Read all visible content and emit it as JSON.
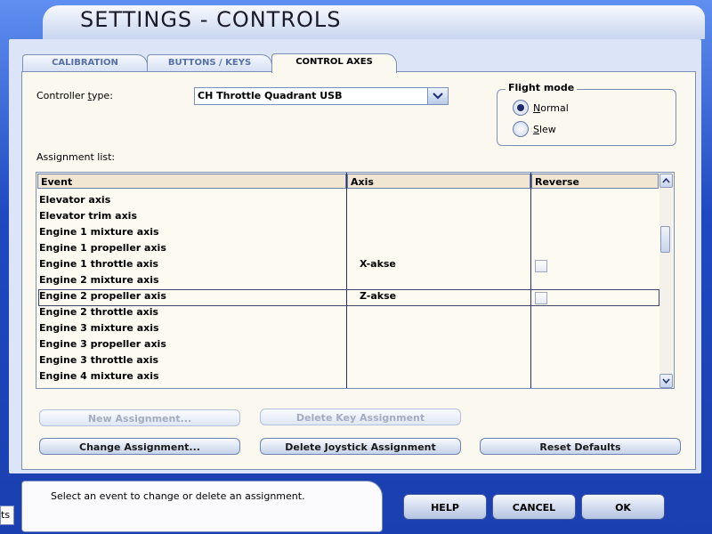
{
  "window": {
    "title": "SETTINGS - CONTROLS"
  },
  "tabs": [
    {
      "label": "CALIBRATION"
    },
    {
      "label": "BUTTONS / KEYS"
    },
    {
      "label": "CONTROL AXES",
      "active": true
    }
  ],
  "controller": {
    "label": "Controller type:",
    "value": "CH Throttle Quadrant USB"
  },
  "flight_mode": {
    "legend": "Flight mode",
    "options": [
      {
        "label": "Normal",
        "selected": true
      },
      {
        "label": "Slew",
        "selected": false
      }
    ]
  },
  "assignment": {
    "label": "Assignment list:",
    "columns": [
      "Event",
      "Axis",
      "Reverse"
    ],
    "rows": [
      {
        "event": "Elevator axis",
        "axis": "",
        "reverse": null
      },
      {
        "event": "Elevator trim axis",
        "axis": "",
        "reverse": null
      },
      {
        "event": "Engine 1 mixture axis",
        "axis": "",
        "reverse": null
      },
      {
        "event": "Engine 1 propeller axis",
        "axis": "",
        "reverse": null
      },
      {
        "event": "Engine 1 throttle axis",
        "axis": "X-akse",
        "reverse": false
      },
      {
        "event": "Engine 2 mixture axis",
        "axis": "",
        "reverse": null
      },
      {
        "event": "Engine 2 propeller axis",
        "axis": "Z-akse",
        "reverse": false,
        "selected": true
      },
      {
        "event": "Engine 2 throttle axis",
        "axis": "",
        "reverse": null
      },
      {
        "event": "Engine 3 mixture axis",
        "axis": "",
        "reverse": null
      },
      {
        "event": "Engine 3 propeller axis",
        "axis": "",
        "reverse": null
      },
      {
        "event": "Engine 3 throttle axis",
        "axis": "",
        "reverse": null
      },
      {
        "event": "Engine 4 mixture axis",
        "axis": "",
        "reverse": null
      }
    ]
  },
  "buttons": {
    "new_assignment": "New Assignment...",
    "delete_key": "Delete Key Assignment",
    "change_assignment": "Change Assignment...",
    "delete_joystick": "Delete Joystick Assignment",
    "reset_defaults": "Reset Defaults"
  },
  "footer": {
    "status_text": "Select an event to change or delete an assignment.",
    "left_stub": "ts",
    "help": "HELP",
    "cancel": "CANCEL",
    "ok": "OK"
  },
  "colors": {
    "frame_blue": "#2a56c8",
    "panel": "#fbf8f0",
    "header_fill": "#f1e6d2"
  }
}
